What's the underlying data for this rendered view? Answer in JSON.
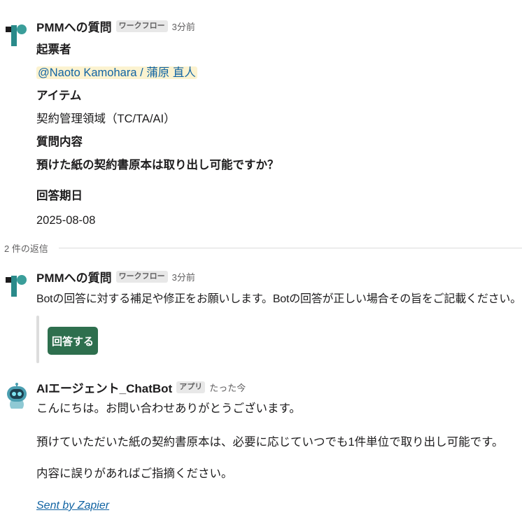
{
  "messages": [
    {
      "sender": "PMMへの質問",
      "badge": "ワークフロー",
      "time": "3分前",
      "fields": {
        "submitter_label": "起票者",
        "submitter_value": "@Naoto Kamohara / 蒲原 直人",
        "item_label": "アイテム",
        "item_value": "契約管理領域（TC/TA/AI）",
        "question_label": "質問内容",
        "question_value": "預けた紙の契約書原本は取り出し可能ですか？",
        "due_label": "回答期日",
        "due_value": "2025-08-08"
      }
    },
    {
      "sender": "PMMへの質問",
      "badge": "ワークフロー",
      "time": "3分前",
      "text": "Botの回答に対する補足や修正をお願いします。Botの回答が正しい場合その旨をご記載ください。",
      "button_label": "回答する"
    },
    {
      "sender": "AIエージェント_ChatBot",
      "badge": "アプリ",
      "time": "たった今",
      "lines": [
        "こんにちは。お問い合わせありがとうございます。",
        "預けていただいた紙の契約書原本は、必要に応じていつでも1件単位で取り出し可能です。",
        "内容に誤りがあればご指摘ください。"
      ],
      "footer_link": "Sent by Zapier"
    }
  ],
  "thread": {
    "replies_label": "2 件の返信"
  },
  "colors": {
    "workflow_avatar_dark": "#1d1c1d",
    "workflow_avatar_teal": "#2a8a8a",
    "button_green": "#2e6f4e",
    "mention_bg": "#fcf3d0",
    "link_blue": "#1264a3",
    "bot_avatar": "#4a9eb0"
  }
}
